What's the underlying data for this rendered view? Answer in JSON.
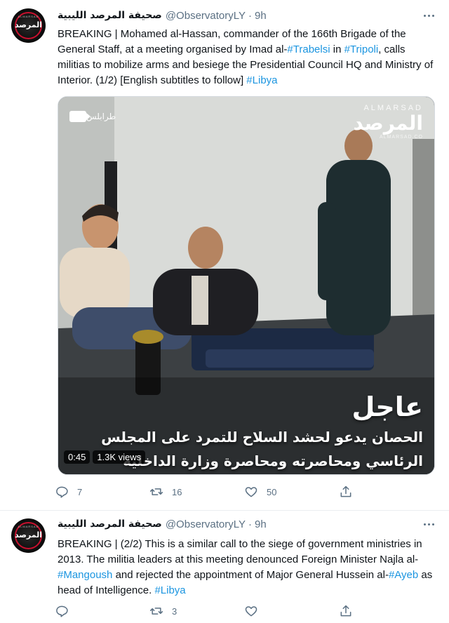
{
  "tweets": [
    {
      "display_name": "صحيفة المرصد الليبية",
      "handle": "@ObservatoryLY",
      "separator": "·",
      "time": "9h",
      "avatar_text": "المرصد",
      "avatar_subtext": "ALMARSAD",
      "text_segments": [
        {
          "t": "BREAKING | Mohamed al-Hassan, commander of the 166th Brigade of the General Staff, at a meeting organised by Imad al-",
          "link": false
        },
        {
          "t": "#Trabelsi",
          "link": true
        },
        {
          "t": " in ",
          "link": false
        },
        {
          "t": "#Tripoli",
          "link": true
        },
        {
          "t": ", calls militias to mobilize arms and besiege the Presidential Council HQ and Ministry of Interior. (1/2) [English subtitles to follow] ",
          "link": false
        },
        {
          "t": "#Libya",
          "link": true
        }
      ],
      "media": {
        "brand_top": "ALMARSAD",
        "brand_ar": "المرصد",
        "brand_sub": "ALMARSAD.CO",
        "city_tag": "طرابلس",
        "urgent": "عاجل",
        "caption_line1": "الحصان يدعو لحشد السلاح للتمرد على المجلس",
        "caption_line2": "الرئاسي ومحاصرته ومحاصرة وزارة الداخلية",
        "duration": "0:45",
        "views": "1.3K views"
      },
      "actions": {
        "reply": "7",
        "retweet": "16",
        "like": "50"
      }
    },
    {
      "display_name": "صحيفة المرصد الليبية",
      "handle": "@ObservatoryLY",
      "separator": "·",
      "time": "9h",
      "avatar_text": "المرصد",
      "avatar_subtext": "ALMARSAD",
      "text_segments": [
        {
          "t": "BREAKING | (2/2) This is a similar call to the siege of government ministries in 2013. The militia leaders at this meeting denounced Foreign Minister Najla al-",
          "link": false
        },
        {
          "t": "#Mangoush",
          "link": true
        },
        {
          "t": " and rejected the appointment of Major General Hussein al-",
          "link": false
        },
        {
          "t": "#Ayeb",
          "link": true
        },
        {
          "t": " as head of Intelligence. ",
          "link": false
        },
        {
          "t": "#Libya",
          "link": true
        }
      ],
      "actions": {
        "reply": "",
        "retweet": "3",
        "like": ""
      }
    }
  ],
  "colors": {
    "link": "#1b95e0",
    "secondary": "#5b7083",
    "brand_red": "#c8102e"
  }
}
